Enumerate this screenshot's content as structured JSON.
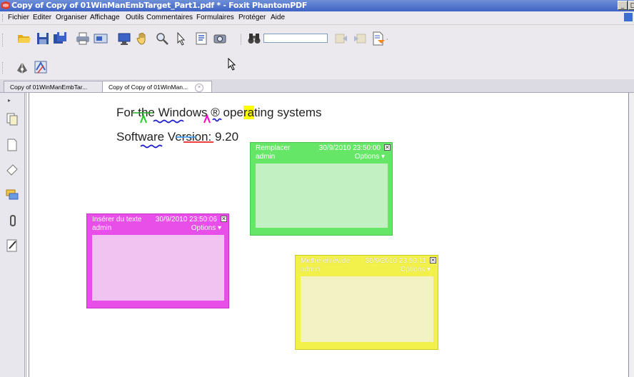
{
  "window": {
    "title": "Copy of Copy of 01WinManEmbTarget_Part1.pdf * - Foxit PhantomPDF",
    "controls": [
      "_",
      "□"
    ]
  },
  "menu": {
    "items": [
      "Fichier",
      "Editer",
      "Organiser",
      "Affichage",
      "Outils",
      "Commentaires",
      "Formulaires",
      "Protéger",
      "Aide"
    ]
  },
  "search": {
    "value": ""
  },
  "tabs": [
    {
      "label": "Copy of 01WinManEmbTar...",
      "active": false
    },
    {
      "label": "Copy of Copy of 01WinMan...",
      "active": true
    }
  ],
  "tab_close_glyph": "×",
  "sidebar_expander": "▸",
  "document": {
    "line1": {
      "a": "For ",
      "b": "the Windows",
      "c": " ® ",
      "d": "ope",
      "e": "ra",
      "f": "ting systems"
    },
    "line2": {
      "a": "Software Version",
      "b": ": 9.20"
    }
  },
  "notes": [
    {
      "id": "green",
      "title": "Remplacer",
      "time": "30/9/2010 23:50:00",
      "author": "admin",
      "options": "Options ▾",
      "color": "#66e666"
    },
    {
      "id": "pink",
      "title": "Insérer du texte",
      "time": "30/9/2010 23:50:06",
      "author": "admin",
      "options": "Options ▾",
      "color": "#e84ee8"
    },
    {
      "id": "yellow",
      "title": "Mettre en évide",
      "time": "30/9/2010 23:50:11",
      "author": "admin",
      "options": "Options ▾",
      "color": "#f2f04a"
    }
  ],
  "note_close_glyph": "✕",
  "icons": {
    "toolbar1": [
      "open-folder-icon",
      "save-icon",
      "save-as-icon",
      "print-icon",
      "email-icon",
      "full-screen-icon",
      "hand-tool-icon",
      "zoom-icon",
      "select-arrow-icon",
      "select-text-icon",
      "snapshot-icon",
      "find-binoculars-icon",
      "prev-result-icon",
      "next-result-icon",
      "document-options-icon"
    ],
    "toolbar2": [
      "pen-tool-icon",
      "stamp-tool-icon"
    ],
    "sidebar": [
      "pages-icon",
      "bookmarks-icon",
      "layers-icon",
      "comments-icon",
      "attachments-icon",
      "signatures-icon"
    ]
  }
}
